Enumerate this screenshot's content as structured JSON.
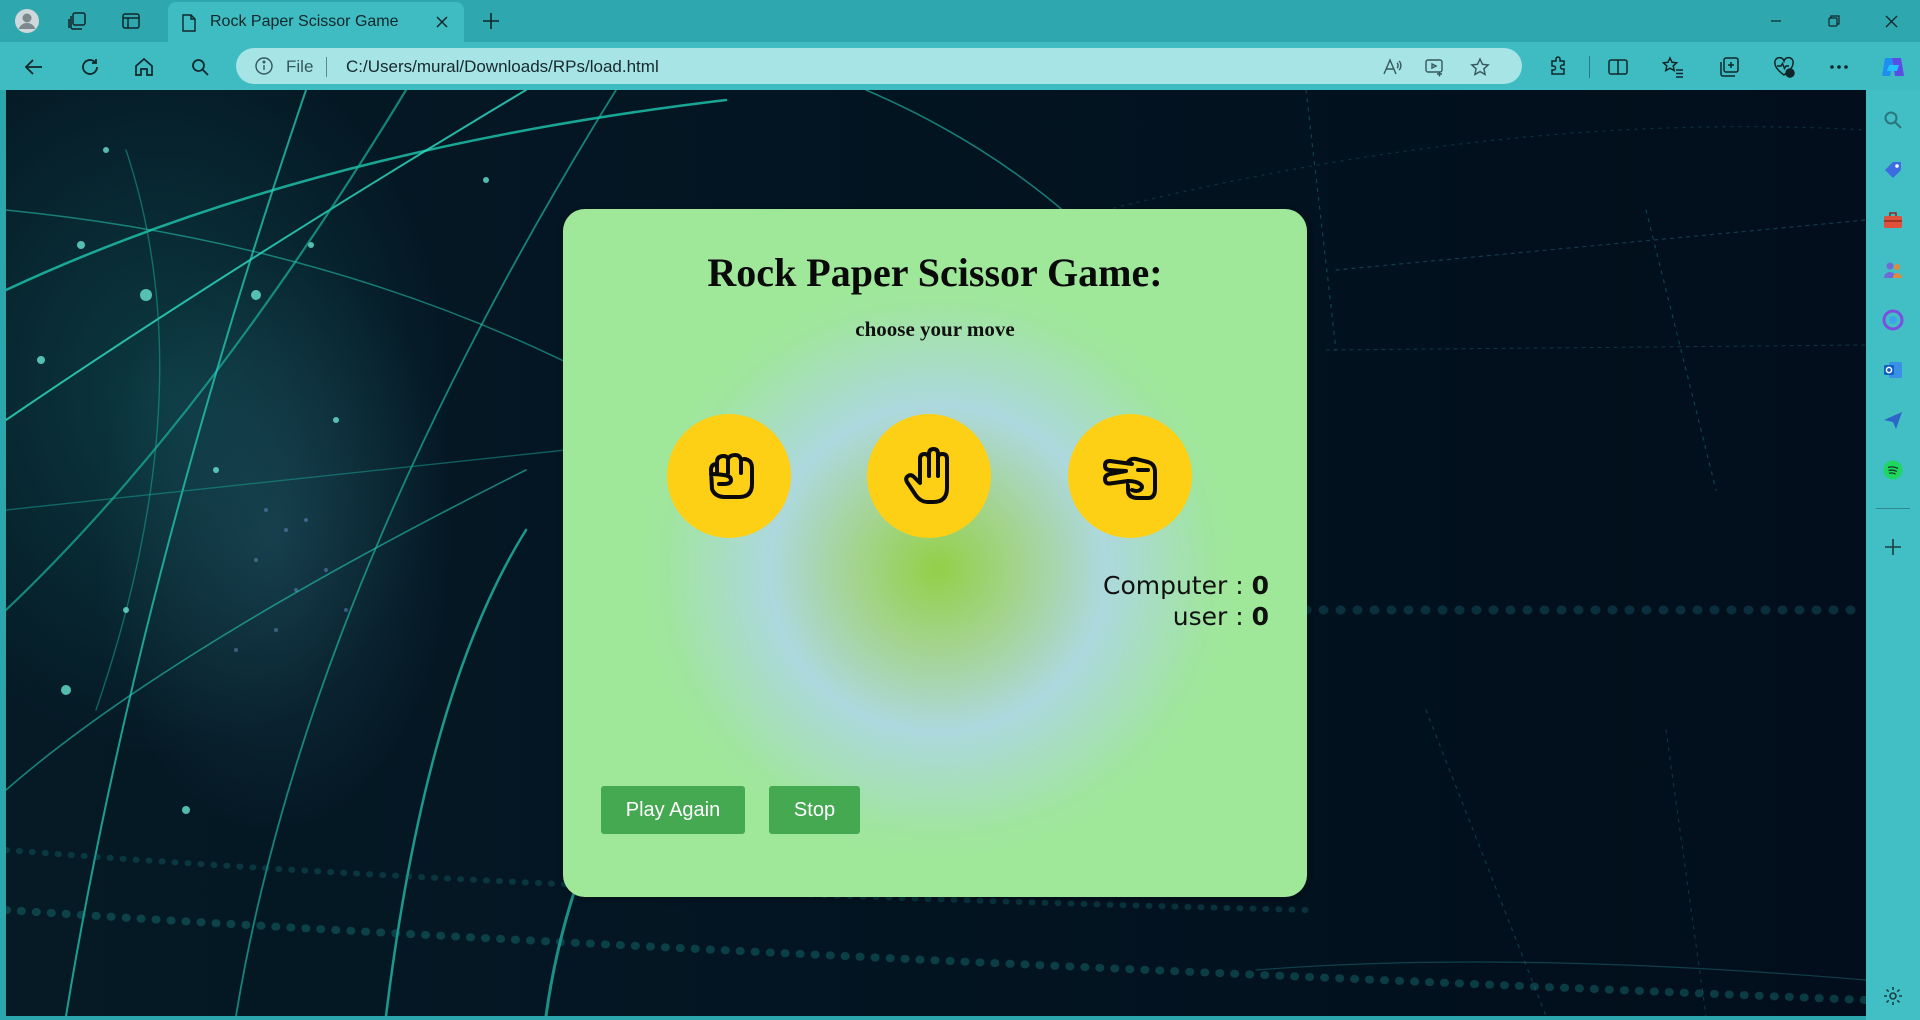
{
  "browser": {
    "tab": {
      "title": "Rock Paper Scissor Game"
    },
    "address": {
      "scheme_label": "File",
      "url": "C:/Users/mural/Downloads/RPs/load.html"
    },
    "icons": {
      "profile": "profile-icon",
      "workspaces": "workspaces-icon",
      "tab_actions": "tab-actions-icon",
      "back": "back-icon",
      "refresh": "refresh-icon",
      "home": "home-icon",
      "search": "search-icon",
      "read_aloud": "read-aloud-icon",
      "app_available": "app-available-icon",
      "favorite": "star-icon",
      "extensions": "puzzle-icon",
      "split_screen": "split-screen-icon",
      "favorites": "favorites-icon",
      "collections": "collections-icon",
      "browser_essentials": "heart-pulse-icon",
      "more": "more-icon",
      "copilot": "copilot-icon"
    },
    "sidebar": [
      "search",
      "tag",
      "toolbox",
      "people",
      "copilot-circle",
      "outlook",
      "send",
      "spotify",
      "add",
      "settings"
    ]
  },
  "game": {
    "title": "Rock Paper Scissor Game:",
    "subtitle": "choose your move",
    "moves": [
      "rock",
      "paper",
      "scissors"
    ],
    "scores": {
      "computer_label": "Computer : ",
      "computer_value": "0",
      "user_label": "user : ",
      "user_value": "0"
    },
    "buttons": {
      "play_again": "Play Again",
      "stop": "Stop"
    }
  },
  "colors": {
    "browser_frame": "#2ea7ae",
    "move_circle": "#fdd015",
    "button": "#44a951",
    "card_edge": "#9fe89a",
    "card_center": "#93d048"
  }
}
